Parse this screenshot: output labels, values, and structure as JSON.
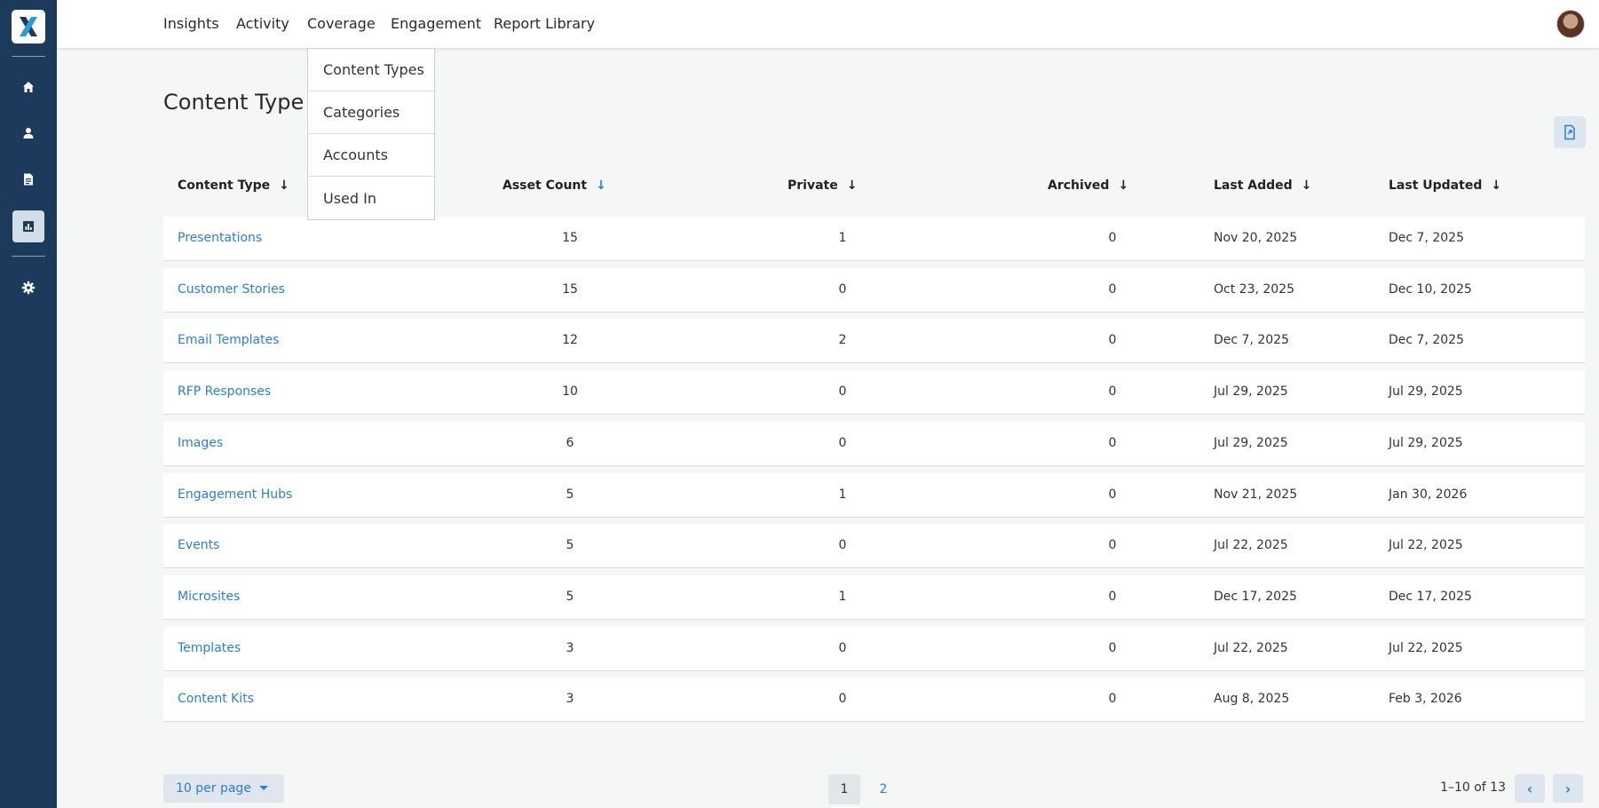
{
  "nav": {
    "items": [
      {
        "label": "Insights"
      },
      {
        "label": "Activity"
      },
      {
        "label": "Coverage"
      },
      {
        "label": "Engagement"
      },
      {
        "label": "Report Library"
      }
    ]
  },
  "coverage_menu": {
    "items": [
      {
        "label": "Content Types"
      },
      {
        "label": "Categories"
      },
      {
        "label": "Accounts"
      },
      {
        "label": "Used In"
      }
    ]
  },
  "page": {
    "title": "Content Type"
  },
  "table": {
    "columns": [
      {
        "label": "Content Type"
      },
      {
        "label": "Asset Count"
      },
      {
        "label": "Private"
      },
      {
        "label": "Archived"
      },
      {
        "label": "Last Added"
      },
      {
        "label": "Last Updated"
      }
    ],
    "rows": [
      {
        "name": "Presentations",
        "asset_count": "15",
        "private": "1",
        "archived": "0",
        "last_added": "Nov 20, 2025",
        "last_updated": "Dec 7, 2025"
      },
      {
        "name": "Customer Stories",
        "asset_count": "15",
        "private": "0",
        "archived": "0",
        "last_added": "Oct 23, 2025",
        "last_updated": "Dec 10, 2025"
      },
      {
        "name": "Email Templates",
        "asset_count": "12",
        "private": "2",
        "archived": "0",
        "last_added": "Dec 7, 2025",
        "last_updated": "Dec 7, 2025"
      },
      {
        "name": "RFP Responses",
        "asset_count": "10",
        "private": "0",
        "archived": "0",
        "last_added": "Jul 29, 2025",
        "last_updated": "Jul 29, 2025"
      },
      {
        "name": "Images",
        "asset_count": "6",
        "private": "0",
        "archived": "0",
        "last_added": "Jul 29, 2025",
        "last_updated": "Jul 29, 2025"
      },
      {
        "name": "Engagement Hubs",
        "asset_count": "5",
        "private": "1",
        "archived": "0",
        "last_added": "Nov 21, 2025",
        "last_updated": "Jan 30, 2026"
      },
      {
        "name": "Events",
        "asset_count": "5",
        "private": "0",
        "archived": "0",
        "last_added": "Jul 22, 2025",
        "last_updated": "Jul 22, 2025"
      },
      {
        "name": "Microsites",
        "asset_count": "5",
        "private": "1",
        "archived": "0",
        "last_added": "Dec 17, 2025",
        "last_updated": "Dec 17, 2025"
      },
      {
        "name": "Templates",
        "asset_count": "3",
        "private": "0",
        "archived": "0",
        "last_added": "Jul 22, 2025",
        "last_updated": "Jul 22, 2025"
      },
      {
        "name": "Content Kits",
        "asset_count": "3",
        "private": "0",
        "archived": "0",
        "last_added": "Aug 8, 2025",
        "last_updated": "Feb 3, 2026"
      }
    ]
  },
  "pagination": {
    "per_page": "10 per page",
    "pages": [
      "1",
      "2"
    ],
    "current_page": "1",
    "range": "1–10 of 13"
  },
  "icons": {
    "logo": "x-logo-icon",
    "sidebar": [
      "home-icon",
      "user-icon",
      "document-icon",
      "bar-chart-icon",
      "gear-icon"
    ],
    "export": "export-file-icon",
    "sort": "arrow-down-icon"
  },
  "colors": {
    "sidebar": "#1b3a5c",
    "accent": "#2b7fd0",
    "background": "#f5f7f6"
  }
}
